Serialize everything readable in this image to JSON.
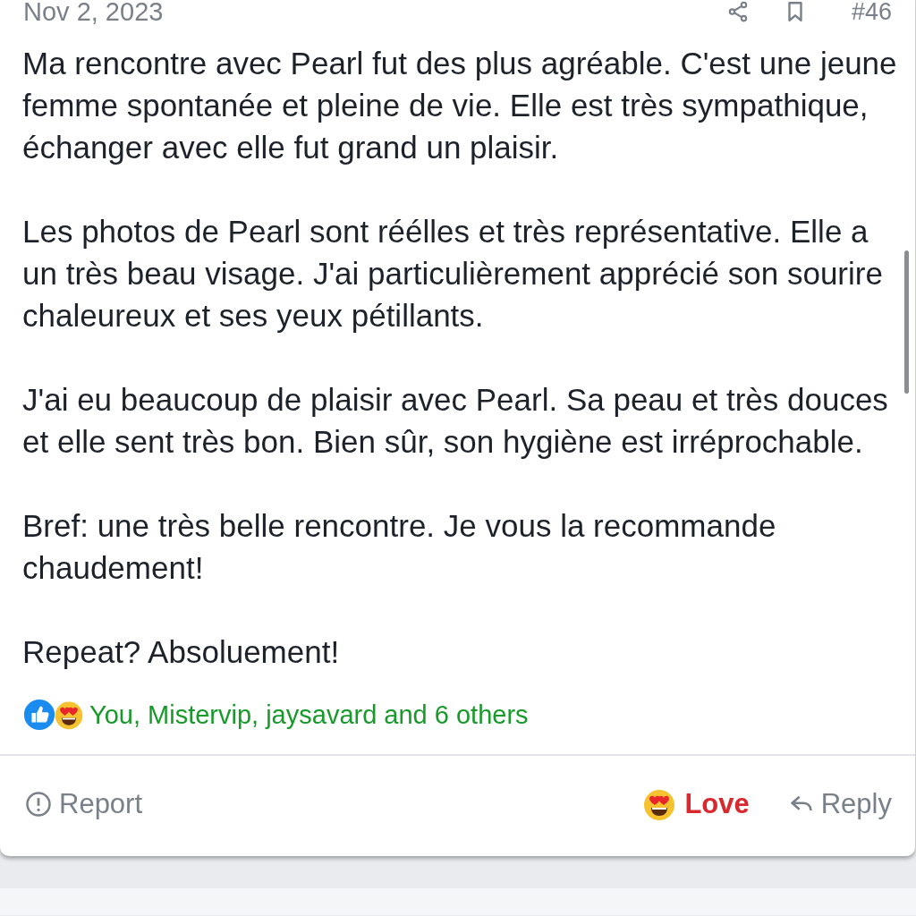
{
  "post": {
    "date": "Nov 2, 2023",
    "number": "#46",
    "paragraphs": [
      "Ma rencontre avec Pearl fut des plus agréable. C'est une jeune femme spontanée et pleine de vie. Elle est très sympathique, échanger avec elle fut grand un plaisir.",
      "Les photos de Pearl sont réélles et très représentative. Elle a un très beau visage. J'ai particulièrement apprécié son sourire chaleureux et ses yeux pétillants.",
      "J'ai eu beaucoup de plaisir avec Pearl. Sa peau et très douces et elle sent très bon. Bien sûr, son hygiène est irréprochable.",
      "Bref: une très belle rencontre. Je vous la recommande chaudement!",
      "Repeat? Absoluement!"
    ],
    "reactions_summary": "You, Mistervip, jaysavard and 6 others",
    "actions": [
      {
        "kind": "report",
        "label": "Report",
        "selected": false
      },
      {
        "kind": "love",
        "label": "Love",
        "selected": true
      },
      {
        "kind": "reply",
        "label": "Reply",
        "selected": false
      }
    ]
  }
}
